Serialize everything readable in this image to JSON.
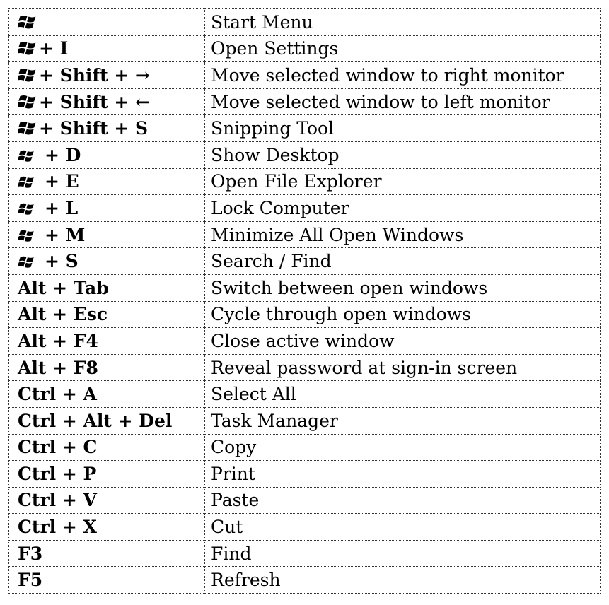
{
  "shortcuts": [
    {
      "win_logo": "large",
      "combo": "",
      "action": "Start Menu"
    },
    {
      "win_logo": "large",
      "combo": "+ I",
      "action": "Open Settings"
    },
    {
      "win_logo": "large",
      "combo": "+ Shift + →",
      "action": "Move selected window to right monitor"
    },
    {
      "win_logo": "large",
      "combo": "+ Shift + ←",
      "action": "Move selected window to left monitor"
    },
    {
      "win_logo": "large",
      "combo": "+ Shift + S",
      "action": "Snipping Tool"
    },
    {
      "win_logo": "small",
      "combo": "+ D",
      "action": "Show Desktop"
    },
    {
      "win_logo": "small",
      "combo": "+ E",
      "action": "Open File Explorer"
    },
    {
      "win_logo": "small",
      "combo": "+ L",
      "action": "Lock Computer"
    },
    {
      "win_logo": "small",
      "combo": "+ M",
      "action": "Minimize All Open Windows"
    },
    {
      "win_logo": "small",
      "combo": "+ S",
      "action": "Search / Find"
    },
    {
      "win_logo": "",
      "combo": "Alt + Tab",
      "action": "Switch between open windows"
    },
    {
      "win_logo": "",
      "combo": "Alt + Esc",
      "action": "Cycle through open windows"
    },
    {
      "win_logo": "",
      "combo": "Alt + F4",
      "action": "Close active window"
    },
    {
      "win_logo": "",
      "combo": "Alt + F8",
      "action": "Reveal password at sign-in screen"
    },
    {
      "win_logo": "",
      "combo": "Ctrl + A",
      "action": "Select All"
    },
    {
      "win_logo": "",
      "combo": "Ctrl + Alt + Del",
      "action": "Task Manager"
    },
    {
      "win_logo": "",
      "combo": "Ctrl + C",
      "action": "Copy"
    },
    {
      "win_logo": "",
      "combo": "Ctrl + P",
      "action": "Print"
    },
    {
      "win_logo": "",
      "combo": "Ctrl + V",
      "action": "Paste"
    },
    {
      "win_logo": "",
      "combo": "Ctrl + X",
      "action": "Cut"
    },
    {
      "win_logo": "",
      "combo": "F3",
      "action": "Find"
    },
    {
      "win_logo": "",
      "combo": "F5",
      "action": "Refresh"
    }
  ],
  "icons": {
    "windows_logo": "windows-logo-icon"
  }
}
